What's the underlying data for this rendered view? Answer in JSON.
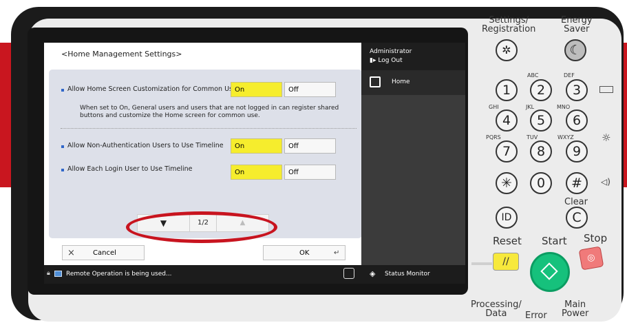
{
  "screen": {
    "title": "<Home Management Settings>",
    "settings": [
      {
        "label": "Allow Home Screen Customization for Common Use",
        "on": "On",
        "off": "Off"
      },
      {
        "label": "Allow Non-Authentication Users to Use Timeline",
        "on": "On",
        "off": "Off"
      },
      {
        "label": "Allow Each Login User to Use Timeline",
        "on": "On",
        "off": "Off"
      }
    ],
    "description": "When set to On, General users and users that are not logged in can register shared buttons and customize the Home screen for common use.",
    "pager": {
      "down": "▼",
      "page": "1/2",
      "up": "▲"
    },
    "cancel_label": "Cancel",
    "ok_label": "OK",
    "status_text": "Remote Operation is being used...",
    "sidebar": {
      "user": "Administrator",
      "logout": "Log Out",
      "home": "Home",
      "status_monitor": "Status Monitor"
    }
  },
  "panel": {
    "settings_registration": "Settings/\nRegistration",
    "energy_saver": "Energy\nSaver",
    "keys": [
      {
        "digit": "1",
        "letters": ""
      },
      {
        "digit": "2",
        "letters": "ABC"
      },
      {
        "digit": "3",
        "letters": "DEF"
      },
      {
        "digit": "4",
        "letters": "GHI"
      },
      {
        "digit": "5",
        "letters": "JKL"
      },
      {
        "digit": "6",
        "letters": "MNO"
      },
      {
        "digit": "7",
        "letters": "PQRS"
      },
      {
        "digit": "8",
        "letters": "TUV"
      },
      {
        "digit": "9",
        "letters": "WXYZ"
      },
      {
        "digit": "0",
        "letters": ""
      }
    ],
    "asterisk": "✳",
    "hash": "#",
    "clear_label": "Clear",
    "clear_key": "C",
    "id_key": "ID",
    "reset_label": "Reset",
    "start_label": "Start",
    "stop_label": "Stop",
    "processing_label": "Processing/\nData",
    "error_label": "Error",
    "main_power_label": "Main\nPower"
  },
  "colors": {
    "brand_red": "#c9161f",
    "on_yellow": "#f6ed2d",
    "start_green": "#16c17c",
    "stop_red": "#f07a7a",
    "reset_yellow": "#f7e93c"
  }
}
